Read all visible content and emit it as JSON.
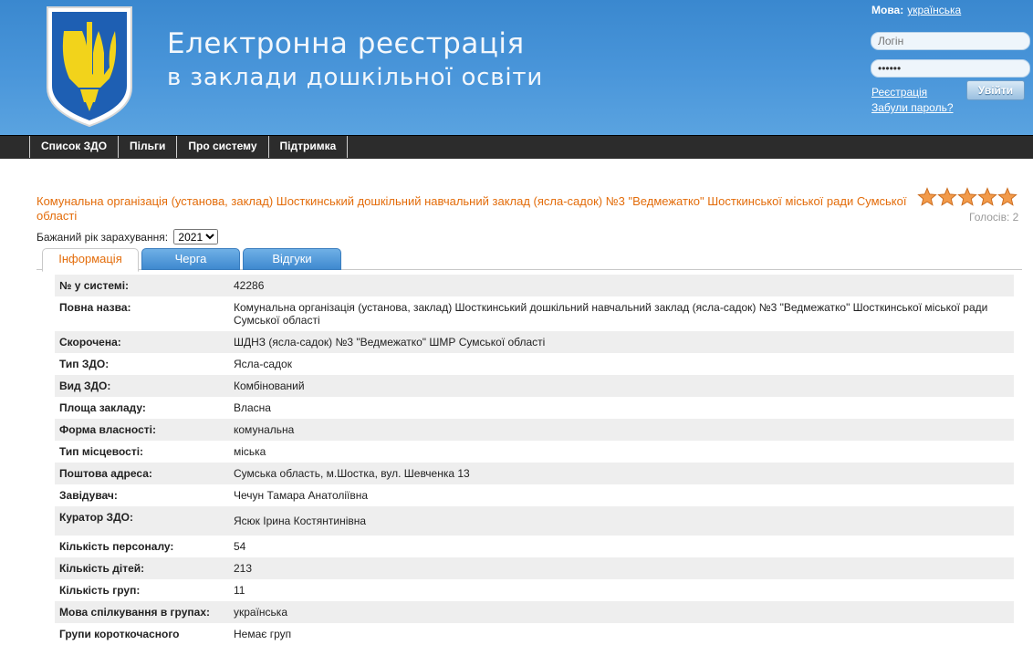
{
  "header": {
    "title_line1": "Електронна реєстрація",
    "title_line2": "в заклади дошкільної освіти",
    "lang_label": "Мова:",
    "lang_value": "українська",
    "login_placeholder": "Логін",
    "password_value": "••••••",
    "register_link": "Реєстрація",
    "forgot_link": "Забули пароль?",
    "login_button": "Увійти"
  },
  "nav": {
    "items": [
      "Список ЗДО",
      "Пільги",
      "Про систему",
      "Підтримка"
    ]
  },
  "org": {
    "name": "Комунальна організація (установа, заклад) Шосткинський дошкільний навчальний заклад (ясла-садок) №3 \"Ведмежатко\" Шосткинської міської ради Сумської області",
    "rating_stars": 5,
    "votes": "Голосів: 2"
  },
  "year": {
    "label": "Бажаний рік зарахування:",
    "selected": "2021"
  },
  "tabs": [
    "Інформація",
    "Черга",
    "Відгуки"
  ],
  "info_rows": [
    {
      "label": "№ у системі:",
      "value": "42286"
    },
    {
      "label": "Повна назва:",
      "value": "Комунальна організація (установа, заклад) Шосткинський дошкільний навчальний заклад (ясла-садок) №3 \"Ведмежатко\" Шосткинської міської ради Сумської області"
    },
    {
      "label": "Скорочена:",
      "value": "ШДНЗ (ясла-садок) №3 \"Ведмежатко\" ШМР Сумської області"
    },
    {
      "label": "Тип ЗДО:",
      "value": "Ясла-садок"
    },
    {
      "label": "Вид ЗДО:",
      "value": "Комбінований"
    },
    {
      "label": "Площа закладу:",
      "value": "Власна"
    },
    {
      "label": "Форма власності:",
      "value": "комунальна"
    },
    {
      "label": "Тип місцевості:",
      "value": "міська"
    },
    {
      "label": "Поштова адреса:",
      "value": "Сумська область, м.Шостка, вул. Шевченка 13"
    },
    {
      "label": "Завідувач:",
      "value": "Чечун Тамара Анатоліївна"
    },
    {
      "label": "Куратор ЗДО:",
      "value": "Ясюк Ірина Костянтинівна"
    },
    {
      "label": "Кількість персоналу:",
      "value": "54"
    },
    {
      "label": "Кількість дітей:",
      "value": "213"
    },
    {
      "label": "Кількість груп:",
      "value": "11"
    },
    {
      "label": "Мова спілкування в групах:",
      "value": "українська"
    },
    {
      "label": "Групи короткочасного",
      "value": "Немає груп"
    }
  ],
  "colors": {
    "header_blue": "#4a96da",
    "nav_dark": "#2c2c2c",
    "org_orange": "#e36c0a",
    "star_orange": "#f29a4a"
  }
}
